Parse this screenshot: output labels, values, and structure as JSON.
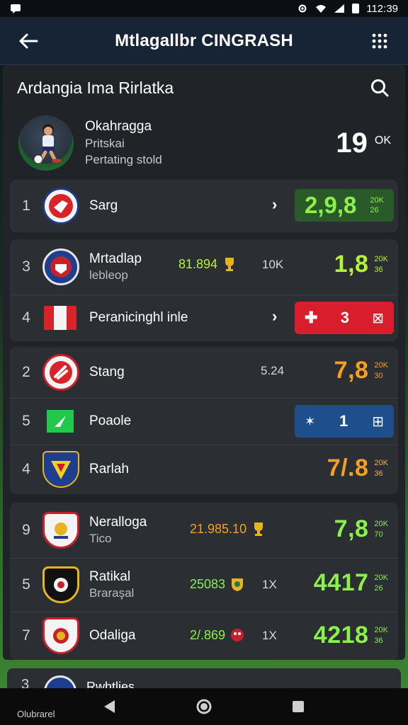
{
  "status_bar": {
    "time": "112:39"
  },
  "app_bar": {
    "title": "Mtlagallbr CINGRASH"
  },
  "section": {
    "title": "Ardangia Ima Rirlatka"
  },
  "profile": {
    "name": "Okahragga",
    "line1": "Pritskai",
    "line2": "Pertating stold",
    "score": "19",
    "unit": "OK"
  },
  "rows": [
    {
      "rank": "1",
      "name": "Sarg",
      "score": "2,9,8",
      "stat_top": "20K",
      "stat_bottom": "26",
      "score_color": "#8bf04a",
      "box_color": "#2a5a2a"
    },
    {
      "rank": "3",
      "name": "Mrtadlap",
      "sub": "lebleop",
      "mid_value": "81.894",
      "mid_count": "10K",
      "score": "1,8",
      "stat_top": "20K",
      "stat_bottom": "36",
      "score_color": "#b6f335"
    },
    {
      "rank": "4",
      "name": "Peranicinghl inle",
      "box_left": "3",
      "box_color": "#d81e2c"
    },
    {
      "rank": "2",
      "name": "Stang",
      "mid_count": "5.24",
      "score": "7,8",
      "stat_top": "20K",
      "stat_bottom": "30",
      "score_color": "#f5a020"
    },
    {
      "rank": "5",
      "name": "Poaole",
      "box_left": "1",
      "box_color": "#1e4f8c"
    },
    {
      "rank": "4",
      "name": "Rarlah",
      "score": "7/.8",
      "stat_top": "20K",
      "stat_bottom": "36",
      "score_color": "#f5a020"
    },
    {
      "rank": "9",
      "name": "Neralloga",
      "sub": "Tico",
      "mid_value": "21.985.10",
      "score": "7,8",
      "stat_top": "20K",
      "stat_bottom": "70",
      "score_color": "#8bf04a"
    },
    {
      "rank": "5",
      "name": "Ratikal",
      "sub": "Braraşal",
      "mid_value": "25083",
      "mid_count": "1X",
      "score": "4417",
      "stat_top": "20K",
      "stat_bottom": "26",
      "score_color": "#8bf04a"
    },
    {
      "rank": "7",
      "name": "Odaliga",
      "mid_value": "2/.869",
      "mid_count": "1X",
      "score": "4218",
      "stat_top": "20K",
      "stat_bottom": "36",
      "score_color": "#8bf04a"
    }
  ],
  "peek_row": {
    "rank": "3",
    "name": "Rwhtlies"
  },
  "nav": {
    "footnote": "Olubrarel"
  },
  "colors": {
    "app_bar": "#172436",
    "panel": "#202428",
    "card": "#2b2f34",
    "green": "#8bf04a",
    "orange": "#f5a020",
    "red_box": "#d81e2c",
    "blue_box": "#1e4f8c"
  }
}
